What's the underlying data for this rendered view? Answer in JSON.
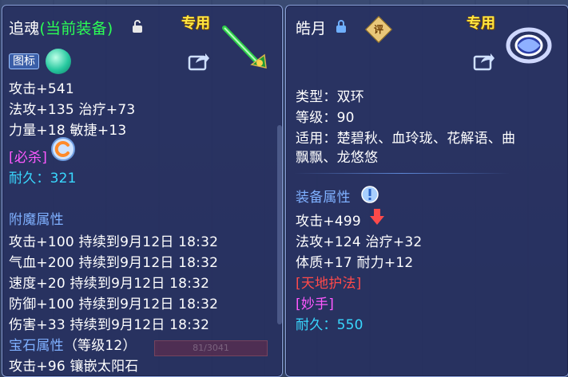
{
  "left": {
    "name": "追魂",
    "status": "(当前装备)",
    "badge": "专用",
    "tag": "图标",
    "stats": [
      "攻击+541",
      "法攻+135 治疗+73",
      "力量+18 敏捷+13"
    ],
    "special": "[必杀]",
    "durability": "耐久：321",
    "enchant_title": "附魔属性",
    "enchant": [
      "攻击+100 持续到9月12日 18:32",
      "气血+200 持续到9月12日 18:32",
      "速度+20 持续到9月12日 18:32",
      "防御+100 持续到9月12日 18:32",
      "伤害+33 持续到9月12日 18:32"
    ],
    "gem_title": "宝石属性",
    "gem_level": "（等级12）",
    "gem": "攻击+96 镶嵌太阳石",
    "bar_text": "81/3041"
  },
  "right": {
    "name": "皓月",
    "badge": "专用",
    "ping": "评",
    "type": "类型：双环",
    "level": "等级：90",
    "suitable_1": "适用：楚碧秋、血玲珑、花解语、曲",
    "suitable_2": "飘飘、龙悠悠",
    "attr_title": "装备属性",
    "stats": [
      "攻击+499",
      "法攻+124 治疗+32",
      "体质+17 耐力+12"
    ],
    "special_1": "[天地护法]",
    "special_2": "[妙手]",
    "durability": "耐久：550"
  },
  "colors": {
    "cyan": "#39d8ff",
    "magenta": "#ff59ff",
    "green": "#2bff55",
    "badge_yellow": "#ffe642",
    "red": "#ff4a4a"
  }
}
